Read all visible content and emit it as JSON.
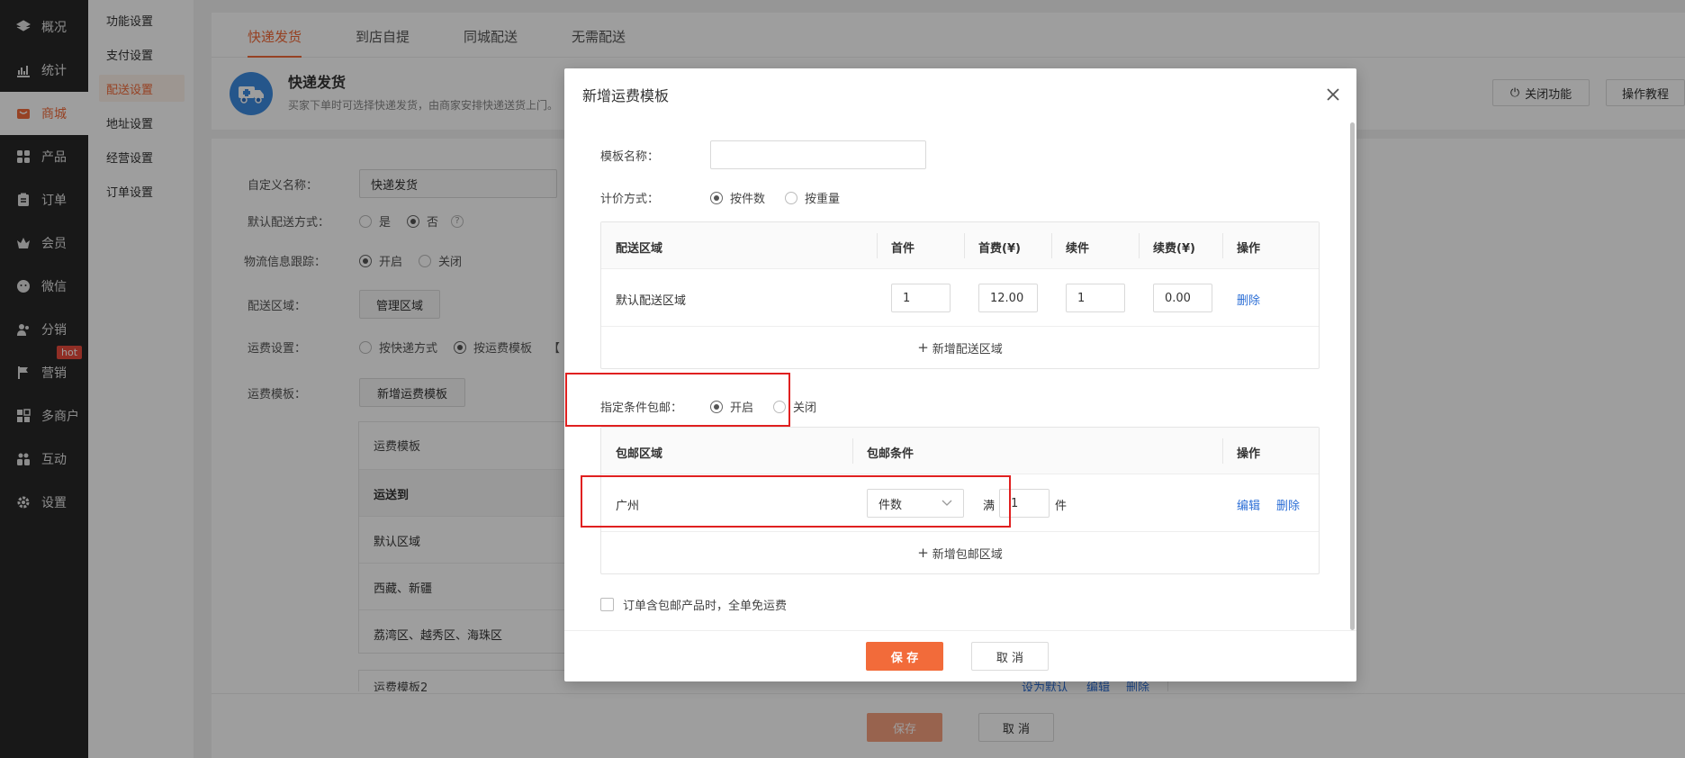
{
  "nav": {
    "items": [
      {
        "label": "概况",
        "icon": "layers-icon"
      },
      {
        "label": "统计",
        "icon": "chart-icon"
      },
      {
        "label": "商城",
        "icon": "shop-icon"
      },
      {
        "label": "产品",
        "icon": "grid-icon"
      },
      {
        "label": "订单",
        "icon": "clipboard-icon"
      },
      {
        "label": "会员",
        "icon": "crown-icon"
      },
      {
        "label": "微信",
        "icon": "wechat-icon"
      },
      {
        "label": "分销",
        "icon": "people-icon"
      },
      {
        "label": "营销",
        "icon": "flag-icon",
        "badge": "hot"
      },
      {
        "label": "多商户",
        "icon": "store-icon"
      },
      {
        "label": "互动",
        "icon": "users-icon"
      },
      {
        "label": "设置",
        "icon": "gear-icon"
      }
    ],
    "active": "商城"
  },
  "submenu": {
    "items": [
      "功能设置",
      "支付设置",
      "配送设置",
      "地址设置",
      "经营设置",
      "订单设置"
    ],
    "active": "配送设置"
  },
  "tabs": [
    "快递发货",
    "到店自提",
    "同城配送",
    "无需配送"
  ],
  "info": {
    "title": "快递发货",
    "desc": "买家下单时可选择快递发货，由商家安排快递送货上门。",
    "close_btn": "关闭功能",
    "tutorial_btn": "操作教程"
  },
  "form": {
    "custom_name_label": "自定义名称：",
    "custom_name_value": "快递发货",
    "default_label": "默认配送方式：",
    "yes": "是",
    "no": "否",
    "help": "?",
    "track_label": "物流信息跟踪：",
    "on": "开启",
    "off": "关闭",
    "area_label": "配送区域：",
    "manage_area_btn": "管理区域",
    "fee_label": "运费设置：",
    "by_express": "按快递方式",
    "by_template": "按运费模板",
    "bracket": "【",
    "template_label": "运费模板：",
    "add_template_btn": "新增运费模板",
    "template_table": {
      "header": "运费模板",
      "ship_to": "运送到",
      "rows": [
        "默认区域",
        "西藏、新疆",
        "荔湾区、越秀区、海珠区"
      ],
      "next_header": "运费模板2",
      "next_actions": [
        "设为默认",
        "编辑",
        "删除"
      ]
    },
    "save_btn": "保存",
    "cancel_btn": "取 消"
  },
  "modal": {
    "title": "新增运费模板",
    "name_label": "模板名称：",
    "name_value": "",
    "pricing_label": "计价方式：",
    "by_count": "按件数",
    "by_weight": "按重量",
    "fee_table": {
      "headers": [
        "配送区域",
        "首件",
        "首费(¥)",
        "续件",
        "续费(¥)",
        "操作"
      ],
      "row": {
        "area": "默认配送区域",
        "first": "1",
        "first_fee": "12.00",
        "next": "1",
        "next_fee": "0.00",
        "action": "删除"
      },
      "add": "新增配送区域"
    },
    "free_label": "指定条件包邮：",
    "free_on": "开启",
    "free_off": "关闭",
    "free_table": {
      "headers": [
        "包邮区域",
        "包邮条件",
        "操作"
      ],
      "row": {
        "area": "广州",
        "condition_type": "件数",
        "full": "满",
        "qty": "1",
        "unit": "件",
        "edit": "编辑",
        "delete": "删除"
      },
      "add": "新增包邮区域"
    },
    "checkbox_label": "订单含包邮产品时，全单免运费",
    "save_btn": "保 存",
    "cancel_btn": "取 消"
  },
  "colors": {
    "accent": "#f26b3a",
    "link": "#2d6fd6",
    "nav_bg": "#282828",
    "highlight": "#e02020"
  }
}
